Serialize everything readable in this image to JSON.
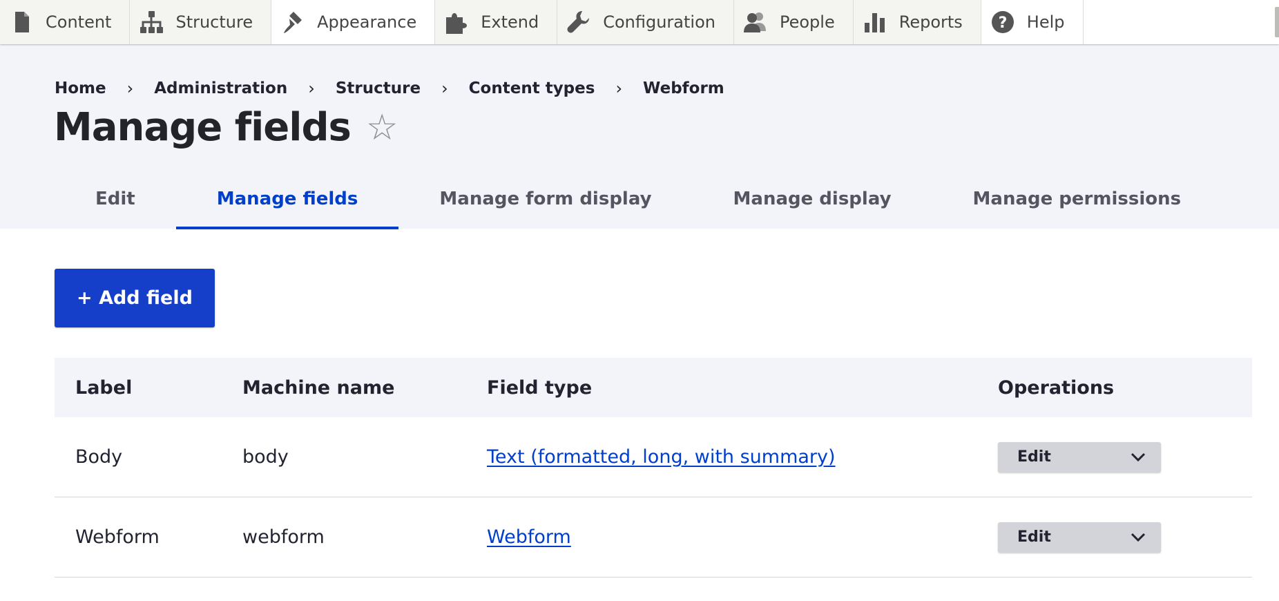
{
  "toolbar": {
    "items": [
      {
        "label": "Content",
        "icon": "file-icon"
      },
      {
        "label": "Structure",
        "icon": "sitemap-icon"
      },
      {
        "label": "Appearance",
        "icon": "paintbrush-icon"
      },
      {
        "label": "Extend",
        "icon": "puzzle-icon"
      },
      {
        "label": "Configuration",
        "icon": "wrench-icon"
      },
      {
        "label": "People",
        "icon": "people-icon"
      },
      {
        "label": "Reports",
        "icon": "bar-chart-icon"
      },
      {
        "label": "Help",
        "icon": "help-icon"
      }
    ]
  },
  "breadcrumb": {
    "items": [
      "Home",
      "Administration",
      "Structure",
      "Content types",
      "Webform"
    ],
    "separator": "›"
  },
  "page": {
    "title": "Manage fields",
    "star": "☆"
  },
  "tabs": {
    "items": [
      "Edit",
      "Manage fields",
      "Manage form display",
      "Manage display",
      "Manage permissions"
    ],
    "active": "Manage fields"
  },
  "add_field": {
    "label": "+ Add field"
  },
  "table": {
    "headers": [
      "Label",
      "Machine name",
      "Field type",
      "Operations"
    ],
    "rows": [
      {
        "label": "Body",
        "machine_name": "body",
        "field_type": "Text (formatted, long, with summary)",
        "operation": "Edit"
      },
      {
        "label": "Webform",
        "machine_name": "webform",
        "field_type": "Webform",
        "operation": "Edit"
      }
    ]
  },
  "colors": {
    "accent": "#003ecc",
    "button": "#163fc9",
    "header_bg": "#f3f4f9",
    "toolbar_bg": "#f4f4f0"
  }
}
